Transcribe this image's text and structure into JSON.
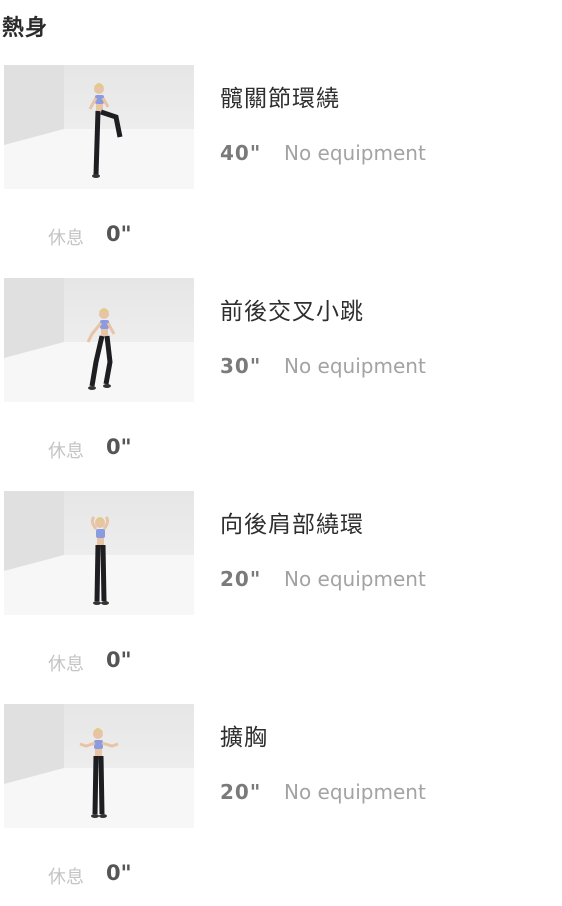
{
  "section": {
    "title": "熱身"
  },
  "exercises": [
    {
      "name": "髖關節環繞",
      "duration": "40\"",
      "equipment": "No equipment",
      "rest_label": "休息",
      "rest_value": "0\"",
      "pose": "knee-lift"
    },
    {
      "name": "前後交叉小跳",
      "duration": "30\"",
      "equipment": "No equipment",
      "rest_label": "休息",
      "rest_value": "0\"",
      "pose": "jump"
    },
    {
      "name": "向後肩部繞環",
      "duration": "20\"",
      "equipment": "No equipment",
      "rest_label": "休息",
      "rest_value": "0\"",
      "pose": "shoulder-circle"
    },
    {
      "name": "擴胸",
      "duration": "20\"",
      "equipment": "No equipment",
      "rest_label": "休息",
      "rest_value": "0\"",
      "pose": "chest-open"
    }
  ],
  "colors": {
    "top": "#8a9be0",
    "legs": "#1e1e22",
    "skin": "#e8c4a6",
    "hair": "#e3c98a",
    "backdrop": "#ececec"
  }
}
